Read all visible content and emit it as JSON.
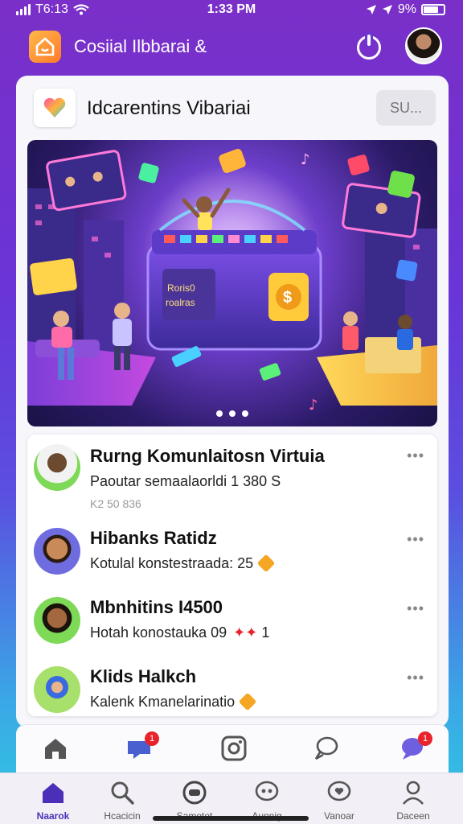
{
  "status_bar": {
    "carrier": "T6:13",
    "time": "1:33 PM",
    "battery": "9%"
  },
  "app": {
    "title": "Cosiial Ilbbarai &"
  },
  "page": {
    "title": "Idcarentins Vibariai",
    "button_label": "SU..."
  },
  "list": [
    {
      "title": "Rurng Komunlaitosn Virtuia",
      "subtitle": "Paoutar semaalaorldi 1 380  S",
      "meta": "K2 50 836",
      "avatar_color": "#7ed957"
    },
    {
      "title": "Hibanks Ratidz",
      "subtitle": "Kotulal konstestraada: 25",
      "avatar_color": "#6e6cdf"
    },
    {
      "title": "Mbnhitins I4500",
      "subtitle": "Hotah konostauka 09",
      "trailing": "1",
      "avatar_color": "#7ed957"
    },
    {
      "title": "Klids Halkch",
      "subtitle": "Kalenk Kmanelarinatio",
      "avatar_color": "#a7e06a"
    }
  ],
  "banner": {
    "sign_text": "Roris0 roalras",
    "carousel_total": 3
  },
  "bottom_nav": [
    {
      "label": "Naarok",
      "icon": "home-icon",
      "active": true
    },
    {
      "label": "Hcacicin",
      "icon": "search-icon"
    },
    {
      "label": "Samotet",
      "icon": "chat-icon"
    },
    {
      "label": "Aunnig",
      "icon": "group-chat-icon"
    },
    {
      "label": "Vanoar",
      "icon": "heart-chat-icon"
    },
    {
      "label": "Daceen",
      "icon": "profile-icon"
    }
  ],
  "action_row": {
    "notifications": [
      "1",
      "1"
    ]
  },
  "colors": {
    "accent": "#4b2fb8",
    "badge": "#e8232b"
  }
}
